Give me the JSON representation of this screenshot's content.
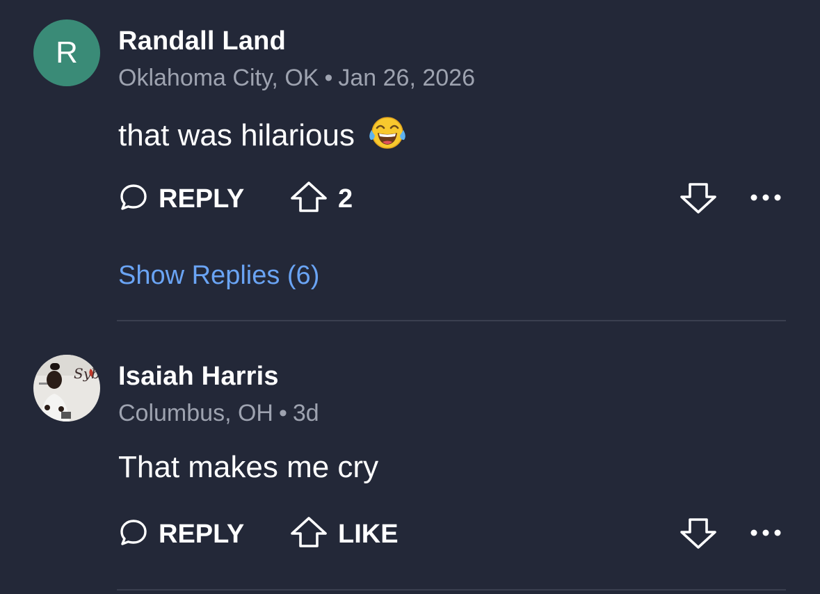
{
  "comments": [
    {
      "avatar_letter": "R",
      "avatar_color": "#3a8b77",
      "author": "Randall Land",
      "location": "Oklahoma City, OK",
      "separator": "•",
      "time": "Jan 26, 2026",
      "text": "that was hilarious",
      "emoji": "face-with-tears-of-joy",
      "actions": {
        "reply_label": "REPLY",
        "upvote_label": "2",
        "downvote_icon": "arrow-down-icon",
        "more_icon": "more-horizontal-icon"
      },
      "show_replies_label": "Show Replies (6)"
    },
    {
      "avatar_image": "profile-photo",
      "author": "Isaiah Harris",
      "location": "Columbus, OH",
      "separator": "•",
      "time": "3d",
      "text": "That makes me cry",
      "actions": {
        "reply_label": "REPLY",
        "upvote_label": "LIKE",
        "downvote_icon": "arrow-down-icon",
        "more_icon": "more-horizontal-icon"
      }
    }
  ],
  "colors": {
    "background": "#232838",
    "link": "#6aa4f4",
    "meta": "#9ea3b0",
    "divider": "#3a3f4f"
  }
}
